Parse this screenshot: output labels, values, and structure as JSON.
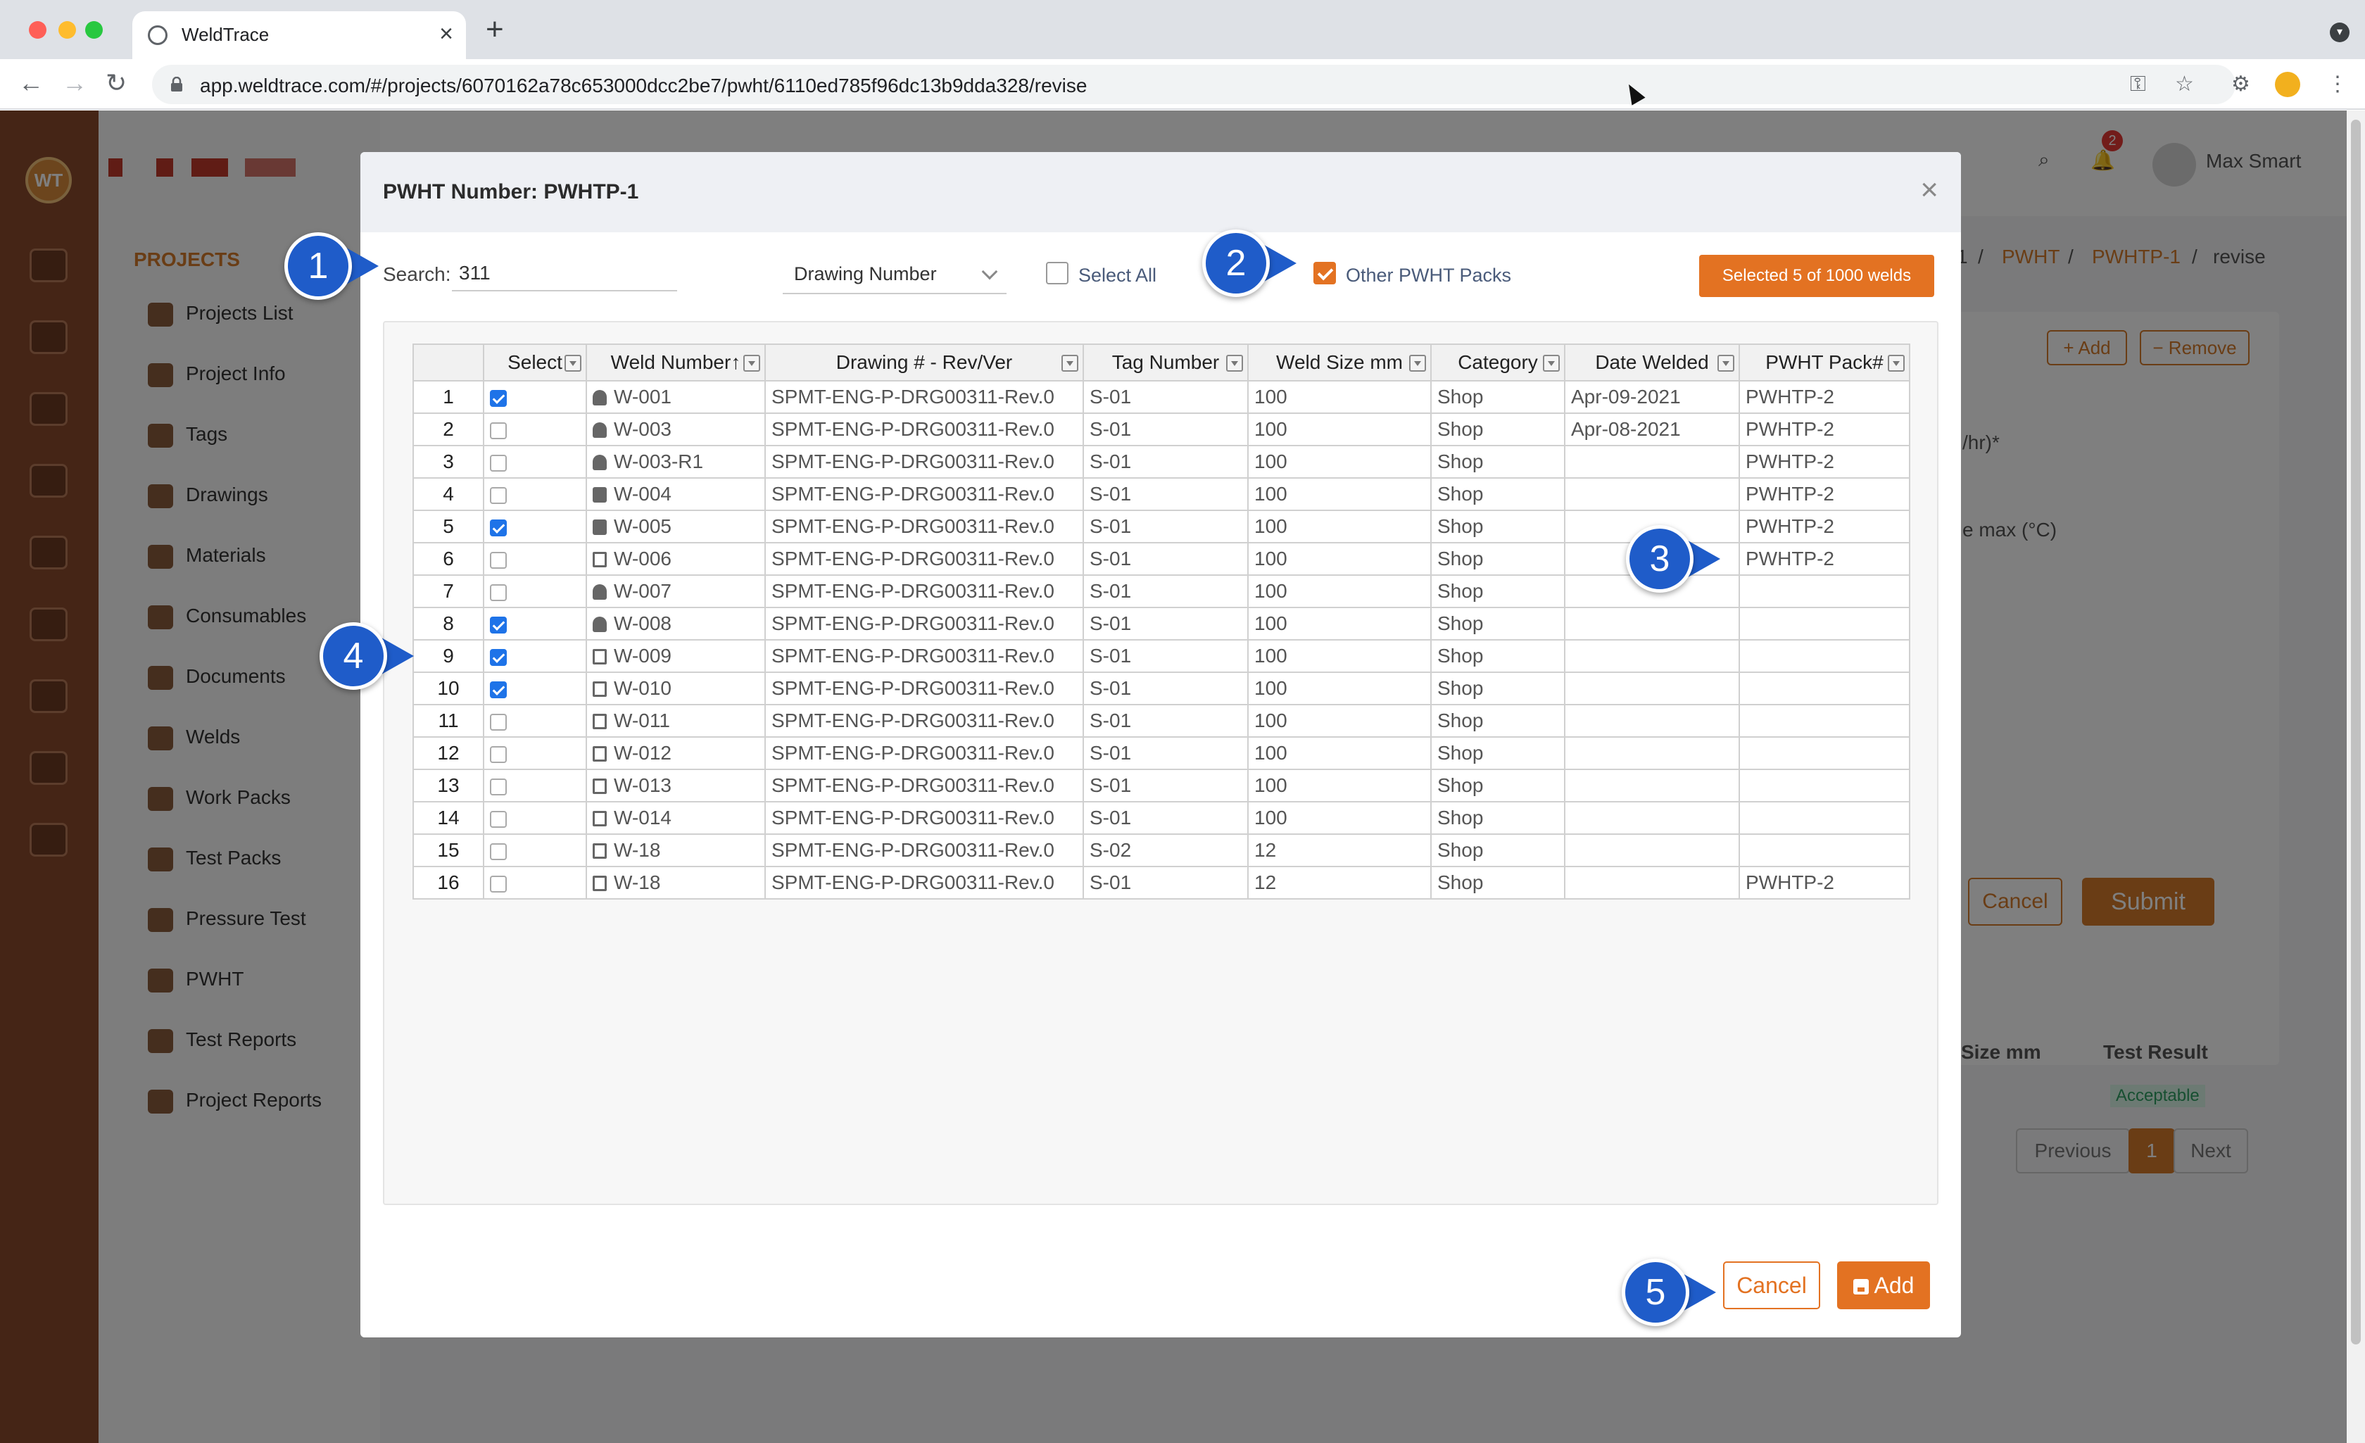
{
  "browser": {
    "tab_title": "WeldTrace",
    "url": "app.weldtrace.com/#/projects/6070162a78c653000dcc2be7/pwht/6110ed785f96dc13b9dda328/revise"
  },
  "app": {
    "sidebar_heading": "PROJECTS",
    "sidebar_items": [
      "Projects List",
      "Project Info",
      "Tags",
      "Drawings",
      "Materials",
      "Consumables",
      "Documents",
      "Welds",
      "Work Packs",
      "Test Packs",
      "Pressure Test",
      "PWHT",
      "Test Reports",
      "Project Reports"
    ],
    "notification_count": "2",
    "user_name": "Max Smart",
    "breadcrumb": [
      "1",
      "/",
      "PWHT",
      "/",
      "PWHTP-1",
      "/",
      "revise"
    ],
    "bg_add": "Add",
    "bg_remove": "Remove",
    "bg_field_1": "/hr)*",
    "bg_field_2": "e max (°C)",
    "bg_cancel": "Cancel",
    "bg_submit": "Submit",
    "bg_col_size": "Size mm",
    "bg_col_result": "Test Result",
    "bg_result_value": "Acceptable",
    "pager": {
      "previous": "Previous",
      "page": "1",
      "next": "Next"
    }
  },
  "modal": {
    "title": "PWHT Number: PWHTP-1",
    "search_label": "Search:",
    "search_value": "311",
    "search_field": "Drawing Number",
    "select_all_label": "Select All",
    "other_packs_label": "Other PWHT Packs",
    "selected_badge": "Selected 5 of 1000 welds",
    "cancel_label": "Cancel",
    "add_label": "Add"
  },
  "table": {
    "columns": [
      "",
      "Select",
      "Weld Number",
      "Drawing # - Rev/Ver",
      "Tag Number",
      "Weld Size mm",
      "Category",
      "Date Welded",
      "PWHT Pack#"
    ],
    "sort_indicator": "↑",
    "rows": [
      {
        "n": "1",
        "selected": true,
        "icon": "person",
        "weld": "W-001",
        "drawing": "SPMT-ENG-P-DRG00311-Rev.0",
        "tag": "S-01",
        "size": "100",
        "category": "Shop",
        "date": "Apr-09-2021",
        "pack": "PWHTP-2"
      },
      {
        "n": "2",
        "selected": false,
        "icon": "person",
        "weld": "W-003",
        "drawing": "SPMT-ENG-P-DRG00311-Rev.0",
        "tag": "S-01",
        "size": "100",
        "category": "Shop",
        "date": "Apr-08-2021",
        "pack": "PWHTP-2"
      },
      {
        "n": "3",
        "selected": false,
        "icon": "person",
        "weld": "W-003-R1",
        "drawing": "SPMT-ENG-P-DRG00311-Rev.0",
        "tag": "S-01",
        "size": "100",
        "category": "Shop",
        "date": "",
        "pack": "PWHTP-2"
      },
      {
        "n": "4",
        "selected": false,
        "icon": "lock",
        "weld": "W-004",
        "drawing": "SPMT-ENG-P-DRG00311-Rev.0",
        "tag": "S-01",
        "size": "100",
        "category": "Shop",
        "date": "",
        "pack": "PWHTP-2"
      },
      {
        "n": "5",
        "selected": true,
        "icon": "lock",
        "weld": "W-005",
        "drawing": "SPMT-ENG-P-DRG00311-Rev.0",
        "tag": "S-01",
        "size": "100",
        "category": "Shop",
        "date": "",
        "pack": "PWHTP-2"
      },
      {
        "n": "6",
        "selected": false,
        "icon": "calendar",
        "weld": "W-006",
        "drawing": "SPMT-ENG-P-DRG00311-Rev.0",
        "tag": "S-01",
        "size": "100",
        "category": "Shop",
        "date": "",
        "pack": "PWHTP-2"
      },
      {
        "n": "7",
        "selected": false,
        "icon": "person",
        "weld": "W-007",
        "drawing": "SPMT-ENG-P-DRG00311-Rev.0",
        "tag": "S-01",
        "size": "100",
        "category": "Shop",
        "date": "",
        "pack": ""
      },
      {
        "n": "8",
        "selected": true,
        "icon": "person",
        "weld": "W-008",
        "drawing": "SPMT-ENG-P-DRG00311-Rev.0",
        "tag": "S-01",
        "size": "100",
        "category": "Shop",
        "date": "",
        "pack": ""
      },
      {
        "n": "9",
        "selected": true,
        "icon": "calendar",
        "weld": "W-009",
        "drawing": "SPMT-ENG-P-DRG00311-Rev.0",
        "tag": "S-01",
        "size": "100",
        "category": "Shop",
        "date": "",
        "pack": ""
      },
      {
        "n": "10",
        "selected": true,
        "icon": "calendar",
        "weld": "W-010",
        "drawing": "SPMT-ENG-P-DRG00311-Rev.0",
        "tag": "S-01",
        "size": "100",
        "category": "Shop",
        "date": "",
        "pack": ""
      },
      {
        "n": "11",
        "selected": false,
        "icon": "calendar",
        "weld": "W-011",
        "drawing": "SPMT-ENG-P-DRG00311-Rev.0",
        "tag": "S-01",
        "size": "100",
        "category": "Shop",
        "date": "",
        "pack": ""
      },
      {
        "n": "12",
        "selected": false,
        "icon": "calendar",
        "weld": "W-012",
        "drawing": "SPMT-ENG-P-DRG00311-Rev.0",
        "tag": "S-01",
        "size": "100",
        "category": "Shop",
        "date": "",
        "pack": ""
      },
      {
        "n": "13",
        "selected": false,
        "icon": "calendar",
        "weld": "W-013",
        "drawing": "SPMT-ENG-P-DRG00311-Rev.0",
        "tag": "S-01",
        "size": "100",
        "category": "Shop",
        "date": "",
        "pack": ""
      },
      {
        "n": "14",
        "selected": false,
        "icon": "calendar",
        "weld": "W-014",
        "drawing": "SPMT-ENG-P-DRG00311-Rev.0",
        "tag": "S-01",
        "size": "100",
        "category": "Shop",
        "date": "",
        "pack": ""
      },
      {
        "n": "15",
        "selected": false,
        "icon": "calendar",
        "weld": "W-18",
        "drawing": "SPMT-ENG-P-DRG00311-Rev.0",
        "tag": "S-02",
        "size": "12",
        "category": "Shop",
        "date": "",
        "pack": ""
      },
      {
        "n": "16",
        "selected": false,
        "icon": "calendar",
        "weld": "W-18",
        "drawing": "SPMT-ENG-P-DRG00311-Rev.0",
        "tag": "S-01",
        "size": "12",
        "category": "Shop",
        "date": "",
        "pack": "PWHTP-2"
      }
    ]
  },
  "callouts": [
    "1",
    "2",
    "3",
    "4",
    "5"
  ],
  "colors": {
    "accent": "#e37222",
    "callout": "#1f5cc9",
    "checkbox": "#1e73e8",
    "rail": "#8a4a2c"
  }
}
